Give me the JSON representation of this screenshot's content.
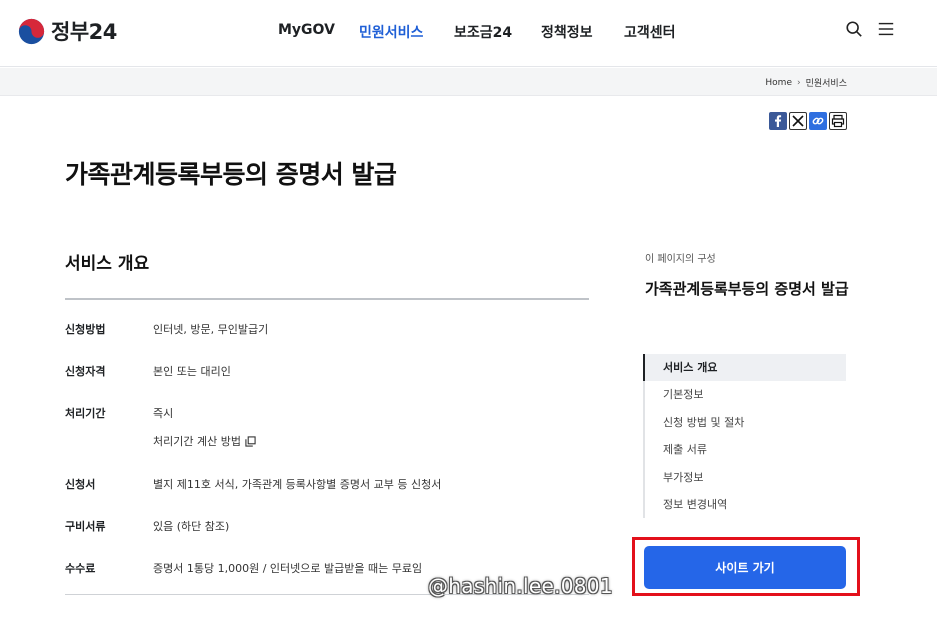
{
  "header": {
    "logo_text": "정부24",
    "nav": [
      {
        "label": "MyGOV",
        "active": false
      },
      {
        "label": "민원서비스",
        "active": true
      },
      {
        "label": "보조금24",
        "active": false
      },
      {
        "label": "정책정보",
        "active": false
      },
      {
        "label": "고객센터",
        "active": false
      }
    ]
  },
  "breadcrumb": {
    "home": "Home",
    "current": "민원서비스"
  },
  "page_title": "가족관계등록부등의 증명서 발급",
  "overview": {
    "title": "서비스 개요",
    "rows": [
      {
        "label": "신청방법",
        "value": "인터넷, 방문, 무인발급기"
      },
      {
        "label": "신청자격",
        "value": "본인 또는 대리인"
      },
      {
        "label": "처리기간",
        "value": "즉시",
        "link": "처리기간 계산 방법"
      },
      {
        "label": "신청서",
        "value": "별지 제11호 서식, 가족관계 등록사항별 증명서 교부 등 신청서"
      },
      {
        "label": "구비서류",
        "value": "있음 (하단 참조)"
      },
      {
        "label": "수수료",
        "value": "증명서 1통당 1,000원 / 인터넷으로 발급받을 때는 무료임"
      }
    ]
  },
  "toc": {
    "caption": "이 페이지의 구성",
    "title": "가족관계등록부등의 증명서 발급",
    "items": [
      {
        "label": "서비스 개요",
        "active": true
      },
      {
        "label": "기본정보",
        "active": false
      },
      {
        "label": "신청 방법 및 절차",
        "active": false
      },
      {
        "label": "제출 서류",
        "active": false
      },
      {
        "label": "부가정보",
        "active": false
      },
      {
        "label": "정보 변경내역",
        "active": false
      }
    ]
  },
  "site_button_label": "사이트 가기",
  "watermark": "@hashin.lee.0801",
  "colors": {
    "accent": "#2566e8",
    "nav_active": "#1f5fd6",
    "highlight": "#e3101b"
  },
  "icons": {
    "share": [
      "facebook-icon",
      "x-icon",
      "link-icon",
      "print-icon"
    ],
    "header": [
      "search-icon",
      "menu-icon"
    ]
  }
}
